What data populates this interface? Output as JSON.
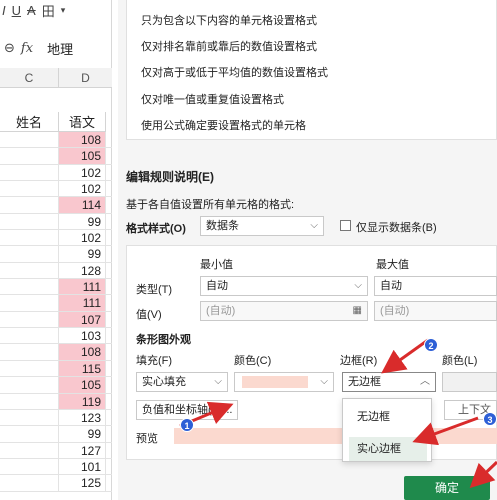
{
  "sheet": {
    "toolbar_glyphs": [
      "I",
      "U",
      "A",
      "田"
    ],
    "formula_bar": {
      "zoom_glyph": "⊖",
      "fx": "fx",
      "value": "地理"
    },
    "columns": [
      "C",
      "D"
    ],
    "header": {
      "c": "姓名",
      "d": "语文"
    },
    "rows": [
      {
        "v": "108",
        "hi": true
      },
      {
        "v": "105",
        "hi": true
      },
      {
        "v": "102",
        "hi": false
      },
      {
        "v": "102",
        "hi": false
      },
      {
        "v": "114",
        "hi": true
      },
      {
        "v": "99",
        "hi": false
      },
      {
        "v": "102",
        "hi": false
      },
      {
        "v": "99",
        "hi": false
      },
      {
        "v": "128",
        "hi": false
      },
      {
        "v": "111",
        "hi": true
      },
      {
        "v": "111",
        "hi": true
      },
      {
        "v": "107",
        "hi": true
      },
      {
        "v": "103",
        "hi": false
      },
      {
        "v": "108",
        "hi": true
      },
      {
        "v": "115",
        "hi": true
      },
      {
        "v": "105",
        "hi": true
      },
      {
        "v": "119",
        "hi": true
      },
      {
        "v": "123",
        "hi": false
      },
      {
        "v": "99",
        "hi": false
      },
      {
        "v": "127",
        "hi": false
      },
      {
        "v": "101",
        "hi": false
      },
      {
        "v": "125",
        "hi": false
      }
    ]
  },
  "dialog": {
    "rule_types": [
      "只为包含以下内容的单元格设置格式",
      "仅对排名靠前或靠后的数值设置格式",
      "仅对高于或低于平均值的数值设置格式",
      "仅对唯一值或重复值设置格式",
      "使用公式确定要设置格式的单元格"
    ],
    "edit_title": "编辑规则说明(E)",
    "hint": "基于各自值设置所有单元格的格式:",
    "format_style_label": "格式样式(O)",
    "format_style_value": "数据条",
    "show_bar_only": "仅显示数据条(B)",
    "min_label": "最小值",
    "max_label": "最大值",
    "type_label": "类型(T)",
    "type_min": "自动",
    "type_max": "自动",
    "value_label": "值(V)",
    "value_min": "(自动)",
    "value_max": "(自动)",
    "bar_appearance": "条形图外观",
    "fill_label": "填充(F)",
    "color_label": "颜色(C)",
    "border_label": "边框(R)",
    "color_l_label": "颜色(L)",
    "fill_value": "实心填充",
    "border_value": "无边框",
    "axis_button": "负值和坐标轴(N)...",
    "direction_button": "上下文",
    "preview_label": "预览",
    "border_options": [
      "无边框",
      "实心边框"
    ],
    "ok_button": "确定"
  },
  "annotations": [
    "1",
    "2",
    "3"
  ],
  "colors": {
    "highlight_cell": "#f9c7ce",
    "bar_fill": "#fbd9cf",
    "ok_button": "#1f8a4c",
    "annotation_arrow": "#d92b2b",
    "marker": "#2d5fd6"
  }
}
